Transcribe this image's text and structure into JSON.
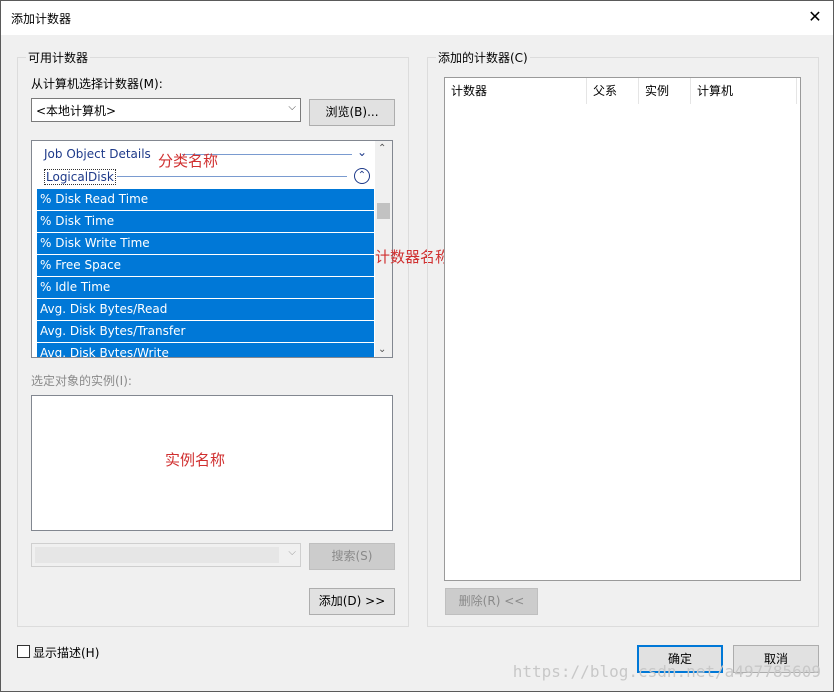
{
  "dialog": {
    "title": "添加计数器",
    "close_glyph": "✕"
  },
  "available": {
    "group_label": "可用计数器",
    "computer_label": "从计算机选择计数器(M):",
    "computer_value": "<本地计算机>",
    "browse_label": "浏览(B)...",
    "categories": [
      {
        "label": "Job Object Details",
        "toggle": "⌄",
        "state": "collapsed"
      },
      {
        "label": "LogicalDisk",
        "toggle": "⌃",
        "state": "expanded"
      }
    ],
    "counters": [
      "% Disk Read Time",
      "% Disk Time",
      "% Disk Write Time",
      "% Free Space",
      "% Idle Time",
      "Avg. Disk Bytes/Read",
      "Avg. Disk Bytes/Transfer",
      "Avg. Disk Bytes/Write"
    ],
    "instances_label": "选定对象的实例(I):",
    "search_label": "搜索(S)",
    "add_label": "添加(D) >>"
  },
  "annotations": {
    "category_name": "分类名称",
    "counter_name": "计数器名称",
    "instance_name": "实例名称"
  },
  "added": {
    "group_label": "添加的计数器(C)",
    "columns": [
      "计数器",
      "父系",
      "实例",
      "计算机"
    ],
    "remove_label": "删除(R) <<"
  },
  "footer": {
    "show_description_label": "显示描述(H)",
    "ok_label": "确定",
    "cancel_label": "取消",
    "watermark": "https://blog.csdn.net/a497785609"
  }
}
